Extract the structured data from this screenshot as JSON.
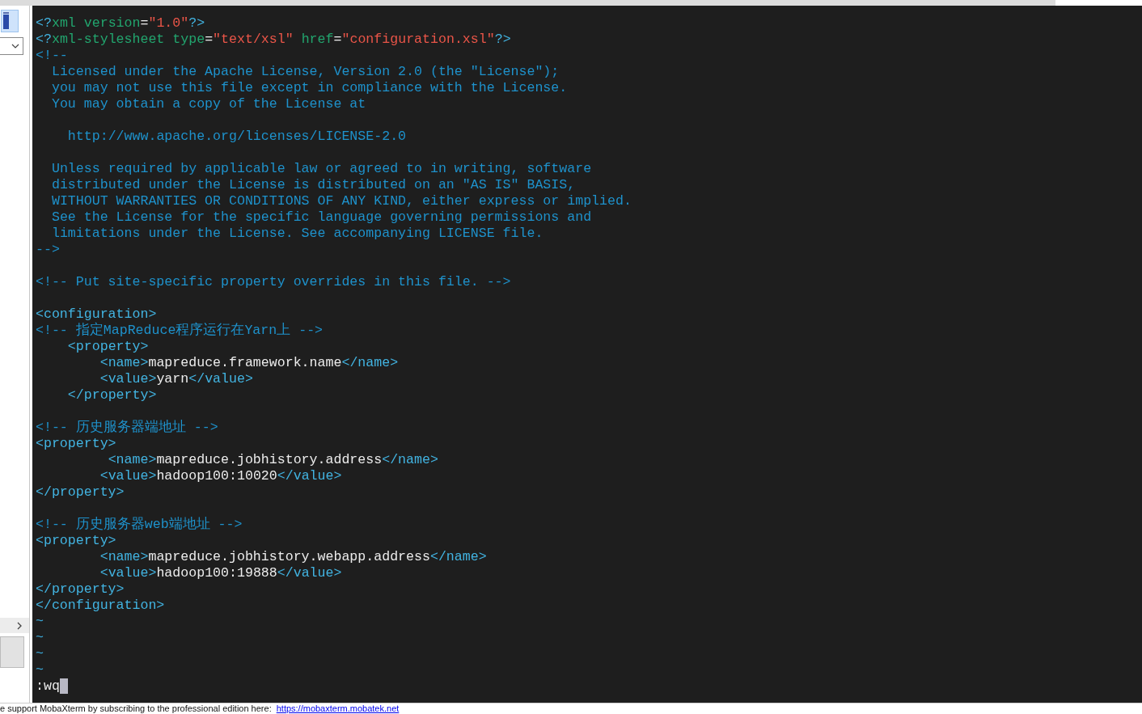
{
  "editor": {
    "lines": [
      {
        "kind": "code",
        "segments": [
          {
            "kind": "tag",
            "text": "<?"
          },
          {
            "kind": "attr",
            "text": "xml version"
          },
          {
            "kind": "text",
            "text": "="
          },
          {
            "kind": "string",
            "text": "\"1.0\""
          },
          {
            "kind": "tag",
            "text": "?>"
          }
        ]
      },
      {
        "kind": "code",
        "segments": [
          {
            "kind": "tag",
            "text": "<?"
          },
          {
            "kind": "attr",
            "text": "xml-stylesheet type"
          },
          {
            "kind": "text",
            "text": "="
          },
          {
            "kind": "string",
            "text": "\"text/xsl\""
          },
          {
            "kind": "attr",
            "text": " href"
          },
          {
            "kind": "text",
            "text": "="
          },
          {
            "kind": "string",
            "text": "\"configuration.xsl\""
          },
          {
            "kind": "tag",
            "text": "?>"
          }
        ]
      },
      {
        "kind": "code",
        "segments": [
          {
            "kind": "comment",
            "text": "<!--"
          }
        ]
      },
      {
        "kind": "code",
        "segments": [
          {
            "kind": "comment",
            "text": "  Licensed under the Apache License, Version 2.0 (the \"License\");"
          }
        ]
      },
      {
        "kind": "code",
        "segments": [
          {
            "kind": "comment",
            "text": "  you may not use this file except in compliance with the License."
          }
        ]
      },
      {
        "kind": "code",
        "segments": [
          {
            "kind": "comment",
            "text": "  You may obtain a copy of the License at"
          }
        ]
      },
      {
        "kind": "blank"
      },
      {
        "kind": "code",
        "segments": [
          {
            "kind": "comment",
            "text": "    http://www.apache.org/licenses/LICENSE-2.0"
          }
        ]
      },
      {
        "kind": "blank"
      },
      {
        "kind": "code",
        "segments": [
          {
            "kind": "comment",
            "text": "  Unless required by applicable law or agreed to in writing, software"
          }
        ]
      },
      {
        "kind": "code",
        "segments": [
          {
            "kind": "comment",
            "text": "  distributed under the License is distributed on an \"AS IS\" BASIS,"
          }
        ]
      },
      {
        "kind": "code",
        "segments": [
          {
            "kind": "comment",
            "text": "  WITHOUT WARRANTIES OR CONDITIONS OF ANY KIND, either express or implied."
          }
        ]
      },
      {
        "kind": "code",
        "segments": [
          {
            "kind": "comment",
            "text": "  See the License for the specific language governing permissions and"
          }
        ]
      },
      {
        "kind": "code",
        "segments": [
          {
            "kind": "comment",
            "text": "  limitations under the License. See accompanying LICENSE file."
          }
        ]
      },
      {
        "kind": "code",
        "segments": [
          {
            "kind": "comment",
            "text": "-->"
          }
        ]
      },
      {
        "kind": "blank"
      },
      {
        "kind": "code",
        "segments": [
          {
            "kind": "comment",
            "text": "<!-- Put site-specific property overrides in this file. -->"
          }
        ]
      },
      {
        "kind": "blank"
      },
      {
        "kind": "code",
        "segments": [
          {
            "kind": "tag",
            "text": "<configuration>"
          }
        ]
      },
      {
        "kind": "code",
        "segments": [
          {
            "kind": "comment",
            "text": "<!-- 指定MapReduce程序运行在Yarn上 -->"
          }
        ]
      },
      {
        "kind": "code",
        "segments": [
          {
            "kind": "tag",
            "text": "    <property>"
          }
        ]
      },
      {
        "kind": "code",
        "segments": [
          {
            "kind": "tag",
            "text": "        <name>"
          },
          {
            "kind": "text",
            "text": "mapreduce.framework.name"
          },
          {
            "kind": "tag",
            "text": "</name>"
          }
        ]
      },
      {
        "kind": "code",
        "segments": [
          {
            "kind": "tag",
            "text": "        <value>"
          },
          {
            "kind": "text",
            "text": "yarn"
          },
          {
            "kind": "tag",
            "text": "</value>"
          }
        ]
      },
      {
        "kind": "code",
        "segments": [
          {
            "kind": "tag",
            "text": "    </property>"
          }
        ]
      },
      {
        "kind": "blank"
      },
      {
        "kind": "code",
        "segments": [
          {
            "kind": "comment",
            "text": "<!-- 历史服务器端地址 -->"
          }
        ]
      },
      {
        "kind": "code",
        "segments": [
          {
            "kind": "tag",
            "text": "<property>"
          }
        ]
      },
      {
        "kind": "code",
        "segments": [
          {
            "kind": "tag",
            "text": "         <name>"
          },
          {
            "kind": "text",
            "text": "mapreduce.jobhistory.address"
          },
          {
            "kind": "tag",
            "text": "</name>"
          }
        ]
      },
      {
        "kind": "code",
        "segments": [
          {
            "kind": "tag",
            "text": "        <value>"
          },
          {
            "kind": "text",
            "text": "hadoop100:10020"
          },
          {
            "kind": "tag",
            "text": "</value>"
          }
        ]
      },
      {
        "kind": "code",
        "segments": [
          {
            "kind": "tag",
            "text": "</property>"
          }
        ]
      },
      {
        "kind": "blank"
      },
      {
        "kind": "code",
        "segments": [
          {
            "kind": "comment",
            "text": "<!-- 历史服务器web端地址 -->"
          }
        ]
      },
      {
        "kind": "code",
        "segments": [
          {
            "kind": "tag",
            "text": "<property>"
          }
        ]
      },
      {
        "kind": "code",
        "segments": [
          {
            "kind": "tag",
            "text": "        <name>"
          },
          {
            "kind": "text",
            "text": "mapreduce.jobhistory.webapp.address"
          },
          {
            "kind": "tag",
            "text": "</name>"
          }
        ]
      },
      {
        "kind": "code",
        "segments": [
          {
            "kind": "tag",
            "text": "        <value>"
          },
          {
            "kind": "text",
            "text": "hadoop100:19888"
          },
          {
            "kind": "tag",
            "text": "</value>"
          }
        ]
      },
      {
        "kind": "code",
        "segments": [
          {
            "kind": "tag",
            "text": "</property>"
          }
        ]
      },
      {
        "kind": "code",
        "segments": [
          {
            "kind": "tag",
            "text": "</configuration>"
          }
        ]
      },
      {
        "kind": "code",
        "segments": [
          {
            "kind": "tilde",
            "text": "~"
          }
        ]
      },
      {
        "kind": "code",
        "segments": [
          {
            "kind": "tilde",
            "text": "~"
          }
        ]
      },
      {
        "kind": "code",
        "segments": [
          {
            "kind": "tilde",
            "text": "~"
          }
        ]
      },
      {
        "kind": "code",
        "segments": [
          {
            "kind": "tilde",
            "text": "~"
          }
        ]
      }
    ],
    "command": ":wq"
  },
  "status_bar": {
    "message": "e support MobaXterm by subscribing to the professional edition here:",
    "link": "https://mobaxterm.mobatek.net"
  }
}
